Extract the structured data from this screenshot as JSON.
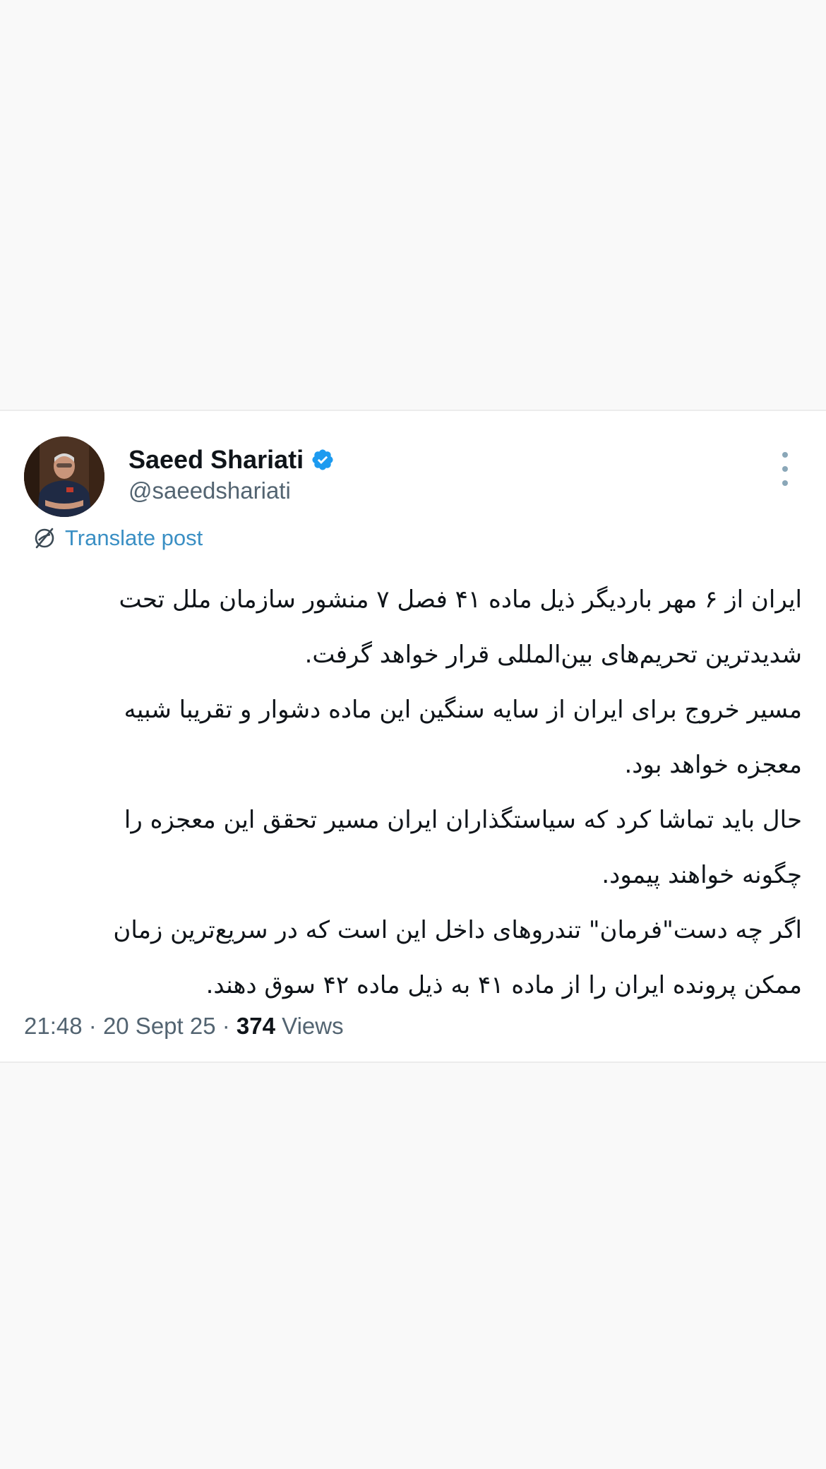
{
  "author": {
    "name": "Saeed Shariati",
    "handle": "@saeedshariati",
    "verified": true
  },
  "translate": {
    "label": "Translate post"
  },
  "post": {
    "paragraphs": [
      "ایران از ۶ مهر باردیگر ذیل ماده ۴۱ فصل ۷ منشور سازمان ملل تحت شدیدترین تحریم‌های بین‌المللی قرار خواهد گرفت.",
      "مسیر خروج برای ایران از سایه سنگین این ماده دشوار و تقریبا شبیه معجزه خواهد بود.",
      "حال باید تماشا کرد که سیاستگذاران ایران مسیر تحقق این معجزه را چگونه خواهند پیمود.",
      "اگر چه دست\"فرمان\" تندروهای داخل این است که در سریع‌ترین زمان ممکن پرونده ایران را از ماده ۴۱ به ذیل ماده ۴۲ سوق دهند."
    ]
  },
  "meta": {
    "time": "21:48",
    "date": "20 Sept 25",
    "separator": "·",
    "views_count": "374",
    "views_label": "Views"
  },
  "colors": {
    "background": "#f9f9f9",
    "card": "#ffffff",
    "text": "#0f1419",
    "secondary": "#536471",
    "link": "#3a8fc4",
    "verified": "#1d9bf0"
  },
  "icons": {
    "verified": "verified-badge-icon",
    "translate": "translate-globe-icon",
    "more": "more-vertical-icon"
  }
}
